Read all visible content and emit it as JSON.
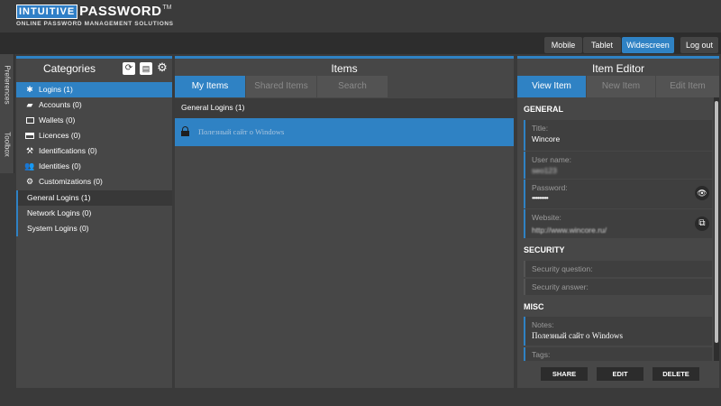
{
  "header": {
    "logo_box": "INTUITIVE",
    "logo_word": "PASSWORD",
    "logo_tm": "TM",
    "logo_sub": "ONLINE PASSWORD MANAGEMENT SOLUTIONS"
  },
  "nav": {
    "mobile": "Mobile",
    "tablet": "Tablet",
    "widescreen": "Widescreen",
    "logout": "Log out"
  },
  "sidetabs": {
    "preferences": "Preferences",
    "toolbox": "Toolbox"
  },
  "categories": {
    "title": "Categories",
    "items": [
      {
        "label": "Logins (1)",
        "icon": "asterisk-icon"
      },
      {
        "label": "Accounts (0)",
        "icon": "book-icon"
      },
      {
        "label": "Wallets (0)",
        "icon": "wallet-icon"
      },
      {
        "label": "Licences (0)",
        "icon": "card-icon"
      },
      {
        "label": "Identifications (0)",
        "icon": "gavel-icon"
      },
      {
        "label": "Identities (0)",
        "icon": "users-icon"
      },
      {
        "label": "Customizations (0)",
        "icon": "gears-icon"
      }
    ],
    "subitems": [
      {
        "label": "General Logins (1)"
      },
      {
        "label": "Network Logins (0)"
      },
      {
        "label": "System Logins (0)"
      }
    ]
  },
  "items": {
    "title": "Items",
    "tabs": [
      "My Items",
      "Shared Items",
      "Search"
    ],
    "group": "General Logins (1)",
    "entry": "Полезный сайт о Windows"
  },
  "editor": {
    "title": "Item Editor",
    "tabs": [
      "View Item",
      "New Item",
      "Edit Item"
    ],
    "general": "GENERAL",
    "title_label": "Title:",
    "title_value": "Wincore",
    "user_label": "User name:",
    "user_value": "seo123",
    "password_label": "Password:",
    "password_value": "•••••••••",
    "website_label": "Website:",
    "website_value": "http://www.wincore.ru/",
    "security": "SECURITY",
    "question_label": "Security question:",
    "answer_label": "Security answer:",
    "misc": "MISC",
    "notes_label": "Notes:",
    "notes_value": "Полезный сайт о Windows",
    "tags_label": "Tags:",
    "share": "SHARE",
    "edit": "EDIT",
    "delete": "DELETE"
  },
  "colors": {
    "accent": "#2f82c4",
    "panel": "#474747",
    "background": "#3a3a3a"
  }
}
